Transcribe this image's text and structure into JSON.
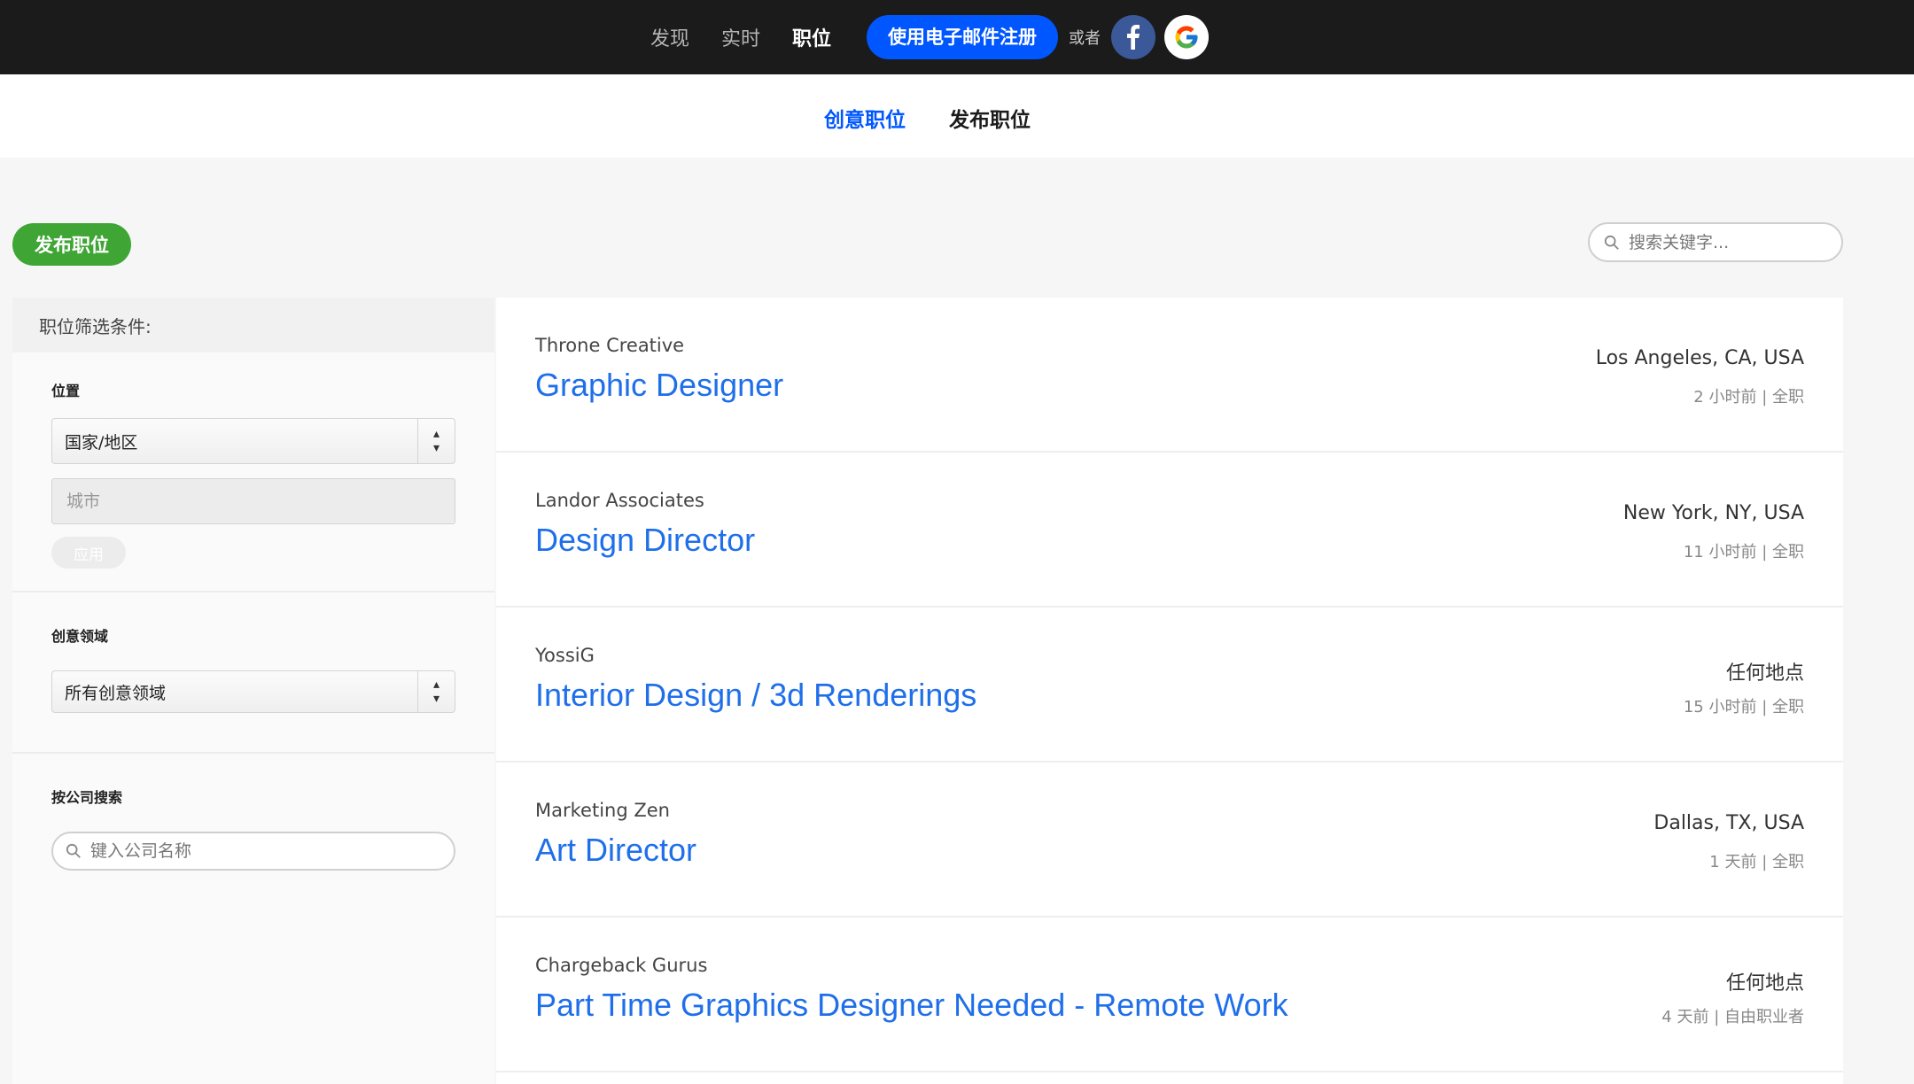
{
  "topnav": {
    "links": [
      {
        "label": "发现",
        "active": false
      },
      {
        "label": "实时",
        "active": false
      },
      {
        "label": "职位",
        "active": true
      }
    ],
    "signup_label": "使用电子邮件注册",
    "or_text": "或者",
    "social": [
      "facebook-icon",
      "google-icon"
    ]
  },
  "subnav": {
    "active_tab": "创意职位",
    "post_tab": "发布职位"
  },
  "toolbar": {
    "post_job_label": "发布职位",
    "search_placeholder": "搜索关键字..."
  },
  "sidebar": {
    "header": "职位筛选条件:",
    "location": {
      "title": "位置",
      "country_select": "国家/地区",
      "city_placeholder": "城市",
      "apply_label": "应用"
    },
    "creative_field": {
      "title": "创意领域",
      "select_value": "所有创意领域"
    },
    "company_search": {
      "title": "按公司搜索",
      "placeholder": "键入公司名称"
    }
  },
  "jobs": [
    {
      "company": "Throne Creative",
      "title": "Graphic Designer",
      "location": "Los Angeles, CA, USA",
      "posted": "2 小时前",
      "type": "全职"
    },
    {
      "company": "Landor Associates",
      "title": "Design Director",
      "location": "New York, NY, USA",
      "posted": "11 小时前",
      "type": "全职"
    },
    {
      "company": "YossiG",
      "title": "Interior Design / 3d Renderings",
      "location": "任何地点",
      "posted": "15 小时前",
      "type": "全职"
    },
    {
      "company": "Marketing Zen",
      "title": "Art Director",
      "location": "Dallas, TX, USA",
      "posted": "1 天前",
      "type": "全职"
    },
    {
      "company": "Chargeback Gurus",
      "title": "Part Time Graphics Designer Needed - Remote Work",
      "location": "任何地点",
      "posted": "4 天前",
      "type": "自由职业者"
    }
  ],
  "colors": {
    "topbar": "#1b1b1b",
    "accent": "#0057ff",
    "green": "#3fa535",
    "job_title": "#1f6fea"
  }
}
